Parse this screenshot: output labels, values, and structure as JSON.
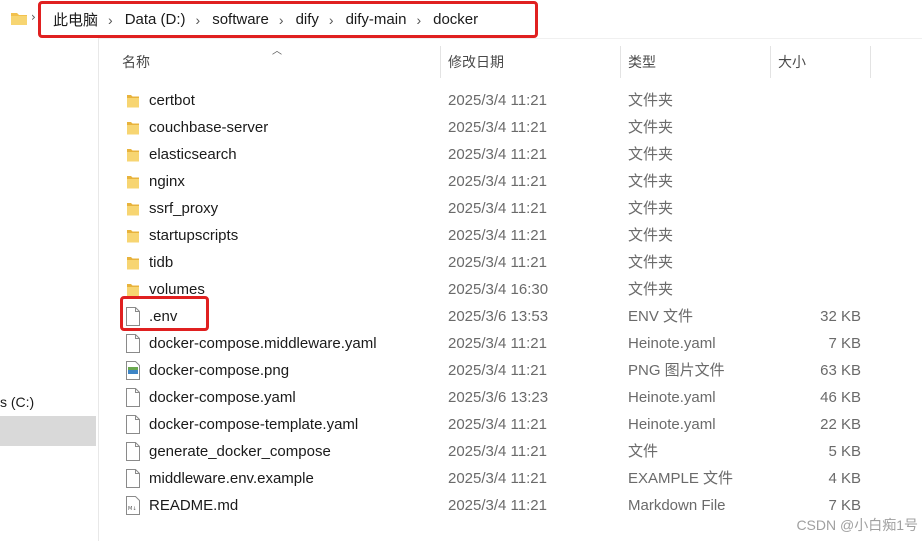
{
  "breadcrumb": [
    "此电脑",
    "Data (D:)",
    "software",
    "dify",
    "dify-main",
    "docker"
  ],
  "sidebar": {
    "drive_label": "s (C:)"
  },
  "columns": {
    "name": "名称",
    "modified": "修改日期",
    "type": "类型",
    "size": "大小"
  },
  "files": [
    {
      "name": "certbot",
      "modified": "2025/3/4 11:21",
      "type": "文件夹",
      "size": "",
      "icon": "folder-icon"
    },
    {
      "name": "couchbase-server",
      "modified": "2025/3/4 11:21",
      "type": "文件夹",
      "size": "",
      "icon": "folder-icon"
    },
    {
      "name": "elasticsearch",
      "modified": "2025/3/4 11:21",
      "type": "文件夹",
      "size": "",
      "icon": "folder-icon"
    },
    {
      "name": "nginx",
      "modified": "2025/3/4 11:21",
      "type": "文件夹",
      "size": "",
      "icon": "folder-icon"
    },
    {
      "name": "ssrf_proxy",
      "modified": "2025/3/4 11:21",
      "type": "文件夹",
      "size": "",
      "icon": "folder-icon"
    },
    {
      "name": "startupscripts",
      "modified": "2025/3/4 11:21",
      "type": "文件夹",
      "size": "",
      "icon": "folder-icon"
    },
    {
      "name": "tidb",
      "modified": "2025/3/4 11:21",
      "type": "文件夹",
      "size": "",
      "icon": "folder-icon"
    },
    {
      "name": "volumes",
      "modified": "2025/3/4 16:30",
      "type": "文件夹",
      "size": "",
      "icon": "folder-icon"
    },
    {
      "name": ".env",
      "modified": "2025/3/6 13:53",
      "type": "ENV 文件",
      "size": "32 KB",
      "icon": "file-icon"
    },
    {
      "name": "docker-compose.middleware.yaml",
      "modified": "2025/3/4 11:21",
      "type": "Heinote.yaml",
      "size": "7 KB",
      "icon": "file-icon"
    },
    {
      "name": "docker-compose.png",
      "modified": "2025/3/4 11:21",
      "type": "PNG 图片文件",
      "size": "63 KB",
      "icon": "image-file-icon"
    },
    {
      "name": "docker-compose.yaml",
      "modified": "2025/3/6 13:23",
      "type": "Heinote.yaml",
      "size": "46 KB",
      "icon": "file-icon"
    },
    {
      "name": "docker-compose-template.yaml",
      "modified": "2025/3/4 11:21",
      "type": "Heinote.yaml",
      "size": "22 KB",
      "icon": "file-icon"
    },
    {
      "name": "generate_docker_compose",
      "modified": "2025/3/4 11:21",
      "type": "文件",
      "size": "5 KB",
      "icon": "file-icon"
    },
    {
      "name": "middleware.env.example",
      "modified": "2025/3/4 11:21",
      "type": "EXAMPLE 文件",
      "size": "4 KB",
      "icon": "file-icon"
    },
    {
      "name": "README.md",
      "modified": "2025/3/4 11:21",
      "type": "Markdown File",
      "size": "7 KB",
      "icon": "markdown-file-icon"
    }
  ],
  "watermark": "CSDN @小白痴1号",
  "colors": {
    "highlight": "#e02020",
    "folder": "#f2c14e",
    "selected": "#d9d9d9"
  }
}
